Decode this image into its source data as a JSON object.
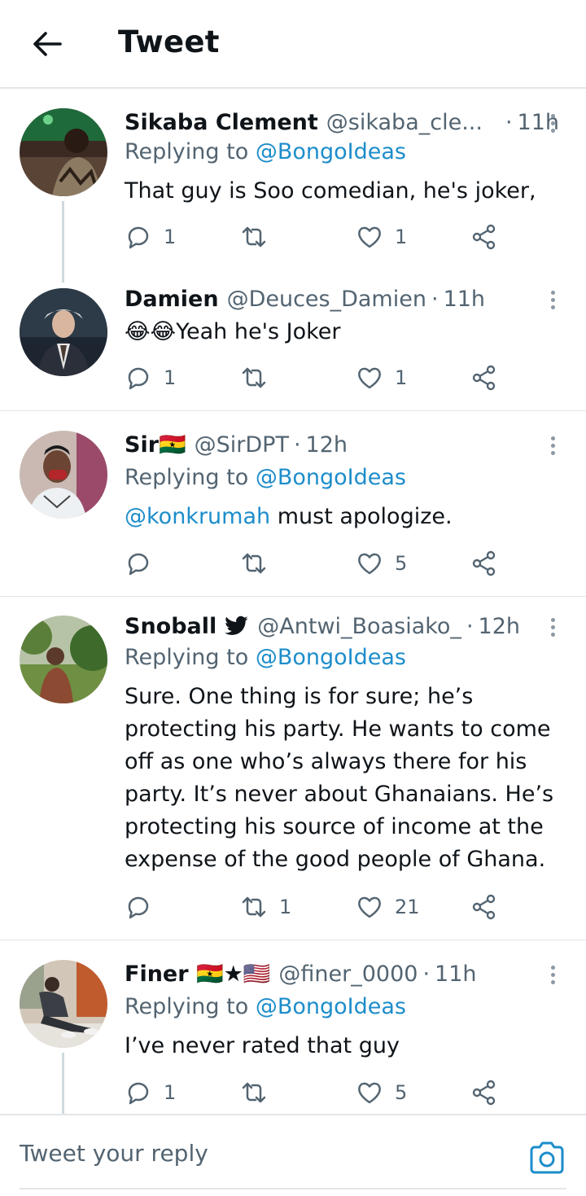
{
  "header": {
    "title": "Tweet"
  },
  "replies": [
    {
      "name": "Sikaba Clement",
      "handle": "@sikaba_cle...",
      "time": "11h",
      "replying_label": "Replying to",
      "replying_to": "@BongoIdeas",
      "text": "That guy is Soo comedian, he's joker,",
      "reply_count": "1",
      "retweet_count": "",
      "like_count": "1"
    },
    {
      "name": "Damien",
      "handle": "@Deuces_Damien",
      "time": "11h",
      "text": "😂😂Yeah he's Joker",
      "reply_count": "1",
      "retweet_count": "",
      "like_count": "1"
    },
    {
      "name": "Sir🇬🇭",
      "handle": "@SirDPT",
      "time": "12h",
      "replying_label": "Replying to",
      "replying_to": "@BongoIdeas",
      "mention": "@konkrumah",
      "text": " must apologize.",
      "reply_count": "",
      "retweet_count": "",
      "like_count": "5"
    },
    {
      "name": "Snoball",
      "handle": "@Antwi_Boasiako_",
      "time": "12h",
      "replying_label": "Replying to",
      "replying_to": "@BongoIdeas",
      "text_lines": [
        "Sure. One thing is for sure; he’s",
        "protecting his party. He wants to come",
        "off as one who’s always there for his",
        "party. It’s never about Ghanaians. He’s",
        "protecting his source of income at the",
        "expense of the good people of Ghana."
      ],
      "reply_count": "",
      "retweet_count": "1",
      "like_count": "21"
    },
    {
      "name": "Finer 🇬🇭★🇺🇸",
      "handle": "@finer_0000",
      "time": "11h",
      "replying_label": "Replying to",
      "replying_to": "@BongoIdeas",
      "text": "I’ve never rated that guy",
      "reply_count": "1",
      "retweet_count": "",
      "like_count": "5"
    }
  ],
  "composer": {
    "placeholder": "Tweet your reply"
  },
  "icons": {
    "back": "arrow-left-icon",
    "reply": "speech-bubble-icon",
    "retweet": "retweet-icon",
    "like": "heart-icon",
    "share": "share-icon",
    "more": "more-vertical-icon",
    "verified_bird": "twitter-bird-icon",
    "camera": "camera-icon"
  },
  "colors": {
    "link": "#1d8dcb",
    "muted": "#536471",
    "text": "#0f1419"
  }
}
